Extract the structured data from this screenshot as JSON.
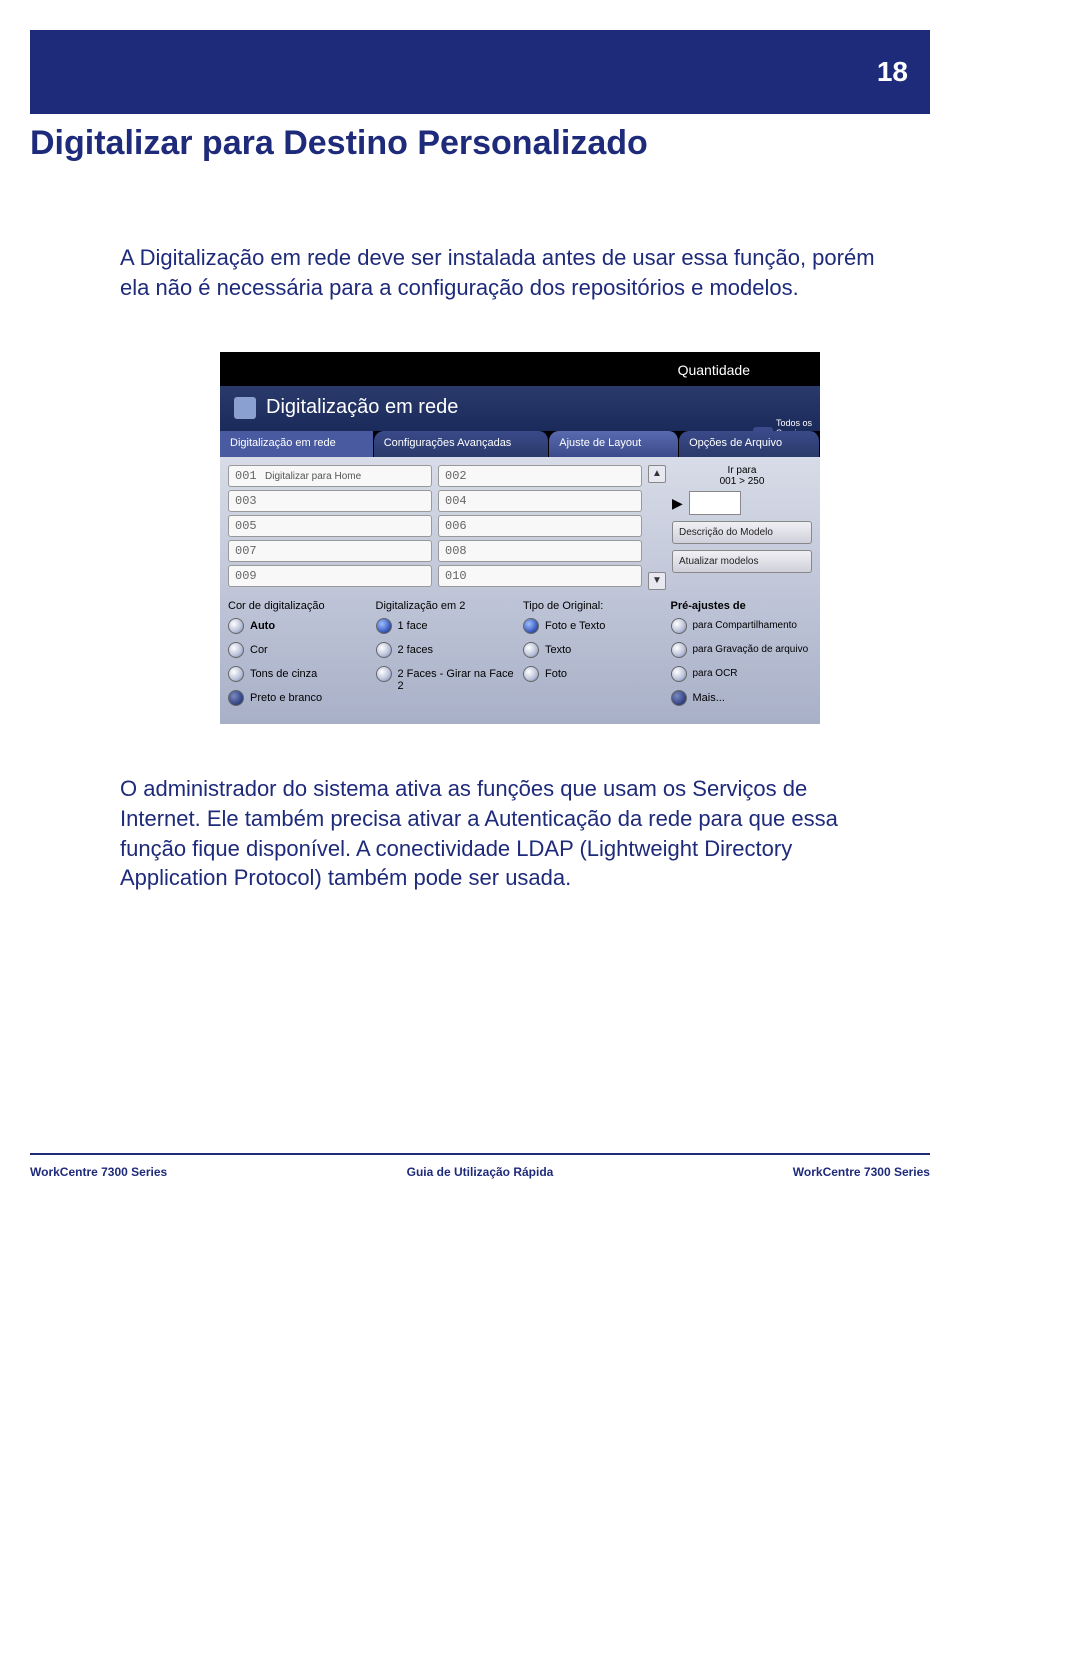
{
  "page_number": "18",
  "page_title": "Digitalizar para Destino Personalizado",
  "intro_text": "A Digitalização em rede deve ser instalada antes de usar essa função, porém ela não é necessária para a configuração dos repositórios e modelos.",
  "outro_text": "O administrador do sistema ativa as funções que usam os Serviços de Internet. Ele também precisa ativar a Autenticação da rede para que essa função fique disponível. A conectividade LDAP (Lightweight Directory Application Protocol) também pode ser usada.",
  "screen": {
    "quantity_label": "Quantidade",
    "all_services": "Todos os\nServiços",
    "title": "Digitalização em rede",
    "tabs": {
      "main": "Digitalização em rede",
      "advanced": "Configurações Avançadas",
      "layout": "Ajuste de Layout",
      "file": "Opções de Arquivo"
    },
    "left_list": [
      {
        "num": "001",
        "text": "Digitalizar para Home"
      },
      {
        "num": "003",
        "text": ""
      },
      {
        "num": "005",
        "text": ""
      },
      {
        "num": "007",
        "text": ""
      },
      {
        "num": "009",
        "text": ""
      }
    ],
    "right_list": [
      {
        "num": "002"
      },
      {
        "num": "004"
      },
      {
        "num": "006"
      },
      {
        "num": "008"
      },
      {
        "num": "010"
      }
    ],
    "goto_label": "Ir para",
    "goto_range": "001 > 250",
    "desc_btn": "Descrição do Modelo",
    "refresh_btn": "Atualizar modelos",
    "col_color": {
      "head": "Cor de digitalização",
      "opts": [
        "Auto",
        "Cor",
        "Tons de cinza",
        "Preto e branco"
      ]
    },
    "col_sides": {
      "head": "Digitalização em 2",
      "opts": [
        "1 face",
        "2 faces",
        "2 Faces - Girar na Face 2"
      ]
    },
    "col_orig": {
      "head": "Tipo de Original:",
      "opts": [
        "Foto e Texto",
        "Texto",
        "Foto"
      ]
    },
    "col_preset": {
      "head": "Pré-ajustes de",
      "opts": [
        "para Compartilhamento",
        "para Gravação de arquivo",
        "para OCR",
        "Mais..."
      ]
    }
  },
  "footer": {
    "left": "WorkCentre 7300 Series",
    "center": "Guia de Utilização Rápida",
    "right": "WorkCentre 7300 Series"
  }
}
